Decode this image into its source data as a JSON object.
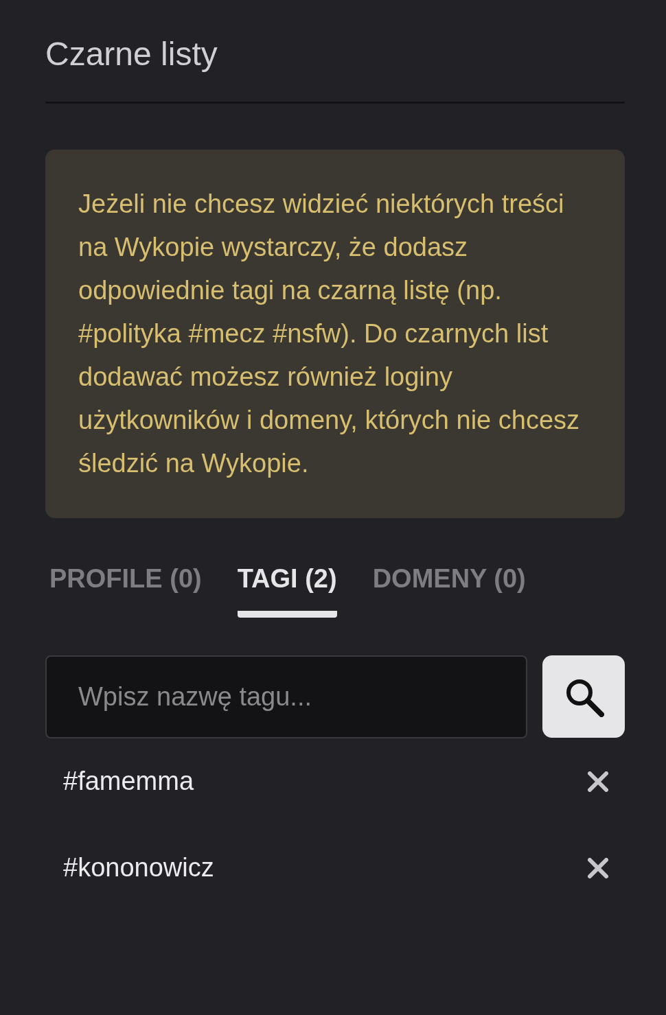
{
  "title": "Czarne listy",
  "info": "Jeżeli nie chcesz widzieć niektórych treści na Wykopie wystarczy, że dodasz odpowiednie tagi na czarną listę (np. #polityka #mecz #nsfw). Do czarnych list dodawać możesz również loginy użytkowników i domeny, których nie chcesz śledzić na Wykopie.",
  "tabs": [
    {
      "label": "PROFILE (0)",
      "selected": false
    },
    {
      "label": "TAGI (2)",
      "selected": true
    },
    {
      "label": "DOMENY (0)",
      "selected": false
    }
  ],
  "search": {
    "placeholder": "Wpisz nazwę tagu..."
  },
  "tags": [
    {
      "name": "#famemma"
    },
    {
      "name": "#kononowicz"
    }
  ]
}
